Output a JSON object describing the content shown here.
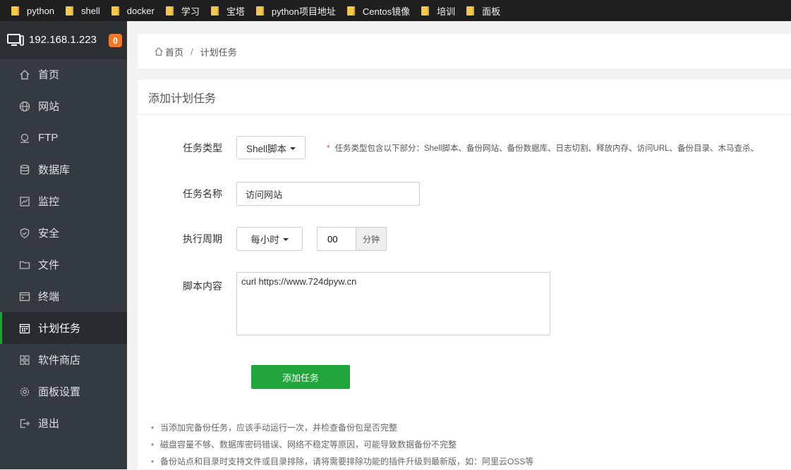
{
  "bookmarks": [
    "python",
    "shell",
    "docker",
    "学习",
    "宝塔",
    "python项目地址",
    "Centos镜像",
    "培训",
    "面板"
  ],
  "sidebar": {
    "server_ip": "192.168.1.223",
    "badge": "0",
    "items": [
      {
        "label": "首页",
        "icon": "home-icon"
      },
      {
        "label": "网站",
        "icon": "globe-icon"
      },
      {
        "label": "FTP",
        "icon": "ftp-icon"
      },
      {
        "label": "数据库",
        "icon": "database-icon"
      },
      {
        "label": "监控",
        "icon": "monitor-chart-icon"
      },
      {
        "label": "安全",
        "icon": "shield-icon"
      },
      {
        "label": "文件",
        "icon": "folder-icon"
      },
      {
        "label": "终端",
        "icon": "terminal-icon"
      },
      {
        "label": "计划任务",
        "icon": "calendar-icon",
        "active": true
      },
      {
        "label": "软件商店",
        "icon": "grid-icon"
      },
      {
        "label": "面板设置",
        "icon": "gear-icon"
      },
      {
        "label": "退出",
        "icon": "logout-icon"
      }
    ]
  },
  "breadcrumb": {
    "home": "首页",
    "separator": "/",
    "current": "计划任务"
  },
  "panel": {
    "title": "添加计划任务",
    "task_type": {
      "label": "任务类型",
      "value": "Shell脚本",
      "hint_star": "*",
      "hint": "任务类型包含以下部分：Shell脚本、备份网站、备份数据库、日志切割、释放内存、访问URL、备份目录、木马查杀、"
    },
    "task_name": {
      "label": "任务名称",
      "value": "访问网站"
    },
    "period": {
      "label": "执行周期",
      "value": "每小时",
      "minute": "00",
      "unit": "分钟"
    },
    "script": {
      "label": "脚本内容",
      "value": "curl https://www.724dpyw.cn"
    },
    "submit_label": "添加任务",
    "notes": [
      "当添加完备份任务，应该手动运行一次，并检查备份包是否完整",
      "磁盘容量不够、数据库密码错误、网络不稳定等原因，可能导致数据备份不完整",
      "备份站点和目录时支持文件或目录排除，请将需要排除功能的插件升级到最新版，如：阿里云OSS等"
    ]
  },
  "colors": {
    "accent": "#20a53a",
    "sidebar_bg": "#333a40",
    "badge": "#f0782a"
  }
}
